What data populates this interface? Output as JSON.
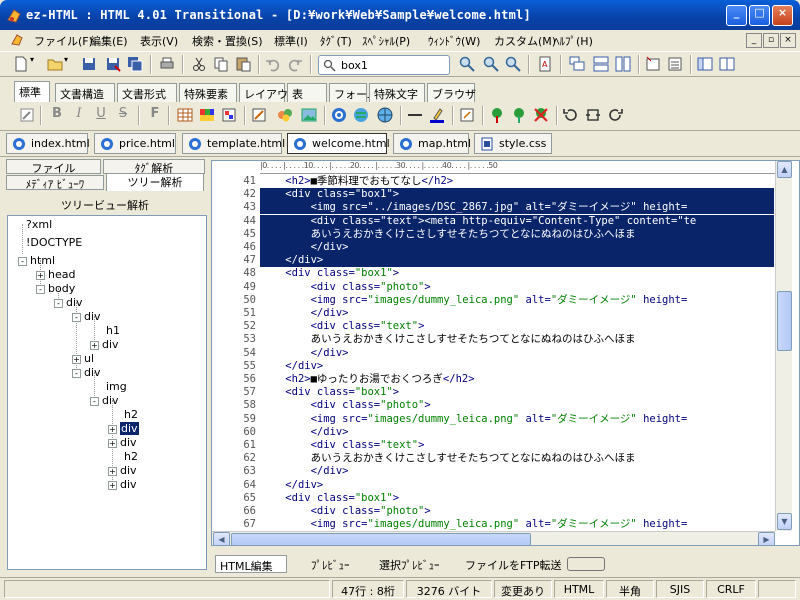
{
  "window": {
    "title": "ez-HTML : HTML 4.01 Transitional - [D:¥work¥Web¥Sample¥welcome.html]",
    "minimize": "_",
    "maximize": "□",
    "close": "×"
  },
  "menu": {
    "items": [
      "ファイル(F)",
      "編集(E)",
      "表示(V)",
      "検索・置換(S)",
      "標準(I)",
      "ﾀｸﾞ(T)",
      "ｽﾍﾟｼｬﾙ(P)",
      "ｳｨﾝﾄﾞｳ(W)",
      "カスタム(M)",
      "ﾍﾙﾌﾟ(H)"
    ],
    "mdi": [
      "_",
      "▫",
      "×"
    ]
  },
  "toolbar": {
    "search_value": "box1"
  },
  "command_tabs": [
    "標準",
    "文書構造",
    "文書形式",
    "特殊要素",
    "レイアウト",
    "表",
    "フォーム",
    "特殊文字",
    "ブラウザ"
  ],
  "file_tabs": [
    "index.html",
    "price.html",
    "template.html",
    "welcome.html",
    "map.html",
    "style.css"
  ],
  "left_panel": {
    "tabs_top": [
      "ファイル",
      "ﾀｸﾞ解析"
    ],
    "tabs_bottom": [
      "ﾒﾃﾞｨｱ ﾋﾞｭｰﾜ",
      "ツリー解析"
    ],
    "header": "ツリービュー解析",
    "tree": [
      {
        "label": "?xml",
        "sign": ""
      },
      {
        "label": "!DOCTYPE",
        "sign": ""
      },
      {
        "label": "html",
        "sign": "-"
      },
      {
        "label": "head",
        "sign": "+"
      },
      {
        "label": "body",
        "sign": "-"
      },
      {
        "label": "div",
        "sign": "-"
      },
      {
        "label": "div",
        "sign": "-"
      },
      {
        "label": "h1",
        "sign": ""
      },
      {
        "label": "div",
        "sign": "+"
      },
      {
        "label": "ul",
        "sign": "+"
      },
      {
        "label": "div",
        "sign": "-"
      },
      {
        "label": "img",
        "sign": ""
      },
      {
        "label": "div",
        "sign": "-"
      },
      {
        "label": "h2",
        "sign": ""
      },
      {
        "label": "div",
        "sign": "+"
      },
      {
        "label": "div",
        "sign": "+"
      },
      {
        "label": "h2",
        "sign": ""
      },
      {
        "label": "div",
        "sign": "+"
      },
      {
        "label": "div",
        "sign": "+"
      }
    ]
  },
  "editor": {
    "ruler": "|0. . . . |. . . . .10. . . . |. . . . .20. . . . |. . . . .30. . . . |. . . . .40. . . . |. . . . .50",
    "lines": [
      {
        "n": "41",
        "text": "    <h2>■季節料理でおもてなし</h2>"
      },
      {
        "n": "42",
        "text": "    <div class=\"box1\">"
      },
      {
        "n": "43",
        "text": "        <img src=\"../images/DSC_2867.jpg\" alt=\"ダミーイメージ\" height="
      },
      {
        "n": "44",
        "text": "        <div class=\"text\"><meta http-equiv=\"Content-Type\" content=\"te"
      },
      {
        "n": "45",
        "text": "        あいうえおかきくけこさしすせそたちつてとなにぬねのはひふへほま"
      },
      {
        "n": "46",
        "text": "        </div>"
      },
      {
        "n": "47",
        "text": "    </div>"
      },
      {
        "n": "48",
        "text": "    <div class=\"box1\">"
      },
      {
        "n": "49",
        "text": "        <div class=\"photo\">"
      },
      {
        "n": "50",
        "text": "        <img src=\"images/dummy_leica.png\" alt=\"ダミーイメージ\" height="
      },
      {
        "n": "51",
        "text": "        </div>"
      },
      {
        "n": "52",
        "text": "        <div class=\"text\">"
      },
      {
        "n": "53",
        "text": "        あいうえおかきくけこさしすせそたちつてとなにぬねのはひふへほま"
      },
      {
        "n": "54",
        "text": "        </div>"
      },
      {
        "n": "55",
        "text": "    </div>"
      },
      {
        "n": "56",
        "text": "    <h2>■ゆったりお湯でおくつろぎ</h2>"
      },
      {
        "n": "57",
        "text": "    <div class=\"box1\">"
      },
      {
        "n": "58",
        "text": "        <div class=\"photo\">"
      },
      {
        "n": "59",
        "text": "        <img src=\"images/dummy_leica.png\" alt=\"ダミーイメージ\" height="
      },
      {
        "n": "60",
        "text": "        </div>"
      },
      {
        "n": "61",
        "text": "        <div class=\"text\">"
      },
      {
        "n": "62",
        "text": "        あいうえおかきくけこさしすせそたちつてとなにぬねのはひふへほま"
      },
      {
        "n": "63",
        "text": "        </div>"
      },
      {
        "n": "64",
        "text": "    </div>"
      },
      {
        "n": "65",
        "text": "    <div class=\"box1\">"
      },
      {
        "n": "66",
        "text": "        <div class=\"photo\">"
      },
      {
        "n": "67",
        "text": "        <img src=\"images/dummy_leica.png\" alt=\"ダミーイメージ\" height="
      }
    ],
    "highlighted": [
      "42",
      "43",
      "44",
      "45",
      "46",
      "47"
    ]
  },
  "bottom_tabs": [
    "HTML編集",
    "ﾌﾟﾚﾋﾞｭｰ",
    "選択ﾌﾟﾚﾋﾞｭｰ",
    "ファイルをFTP転送"
  ],
  "status": {
    "position": "47行 : 8桁",
    "size": "3276 バイト",
    "modified": "変更あり",
    "mode": "HTML",
    "width": "半角",
    "encoding": "SJIS",
    "newline": "CRLF"
  },
  "colors": {
    "titlebar": "#0842a8",
    "selection": "#0a246a",
    "tag": "#000080",
    "attr_value": "#008000"
  }
}
